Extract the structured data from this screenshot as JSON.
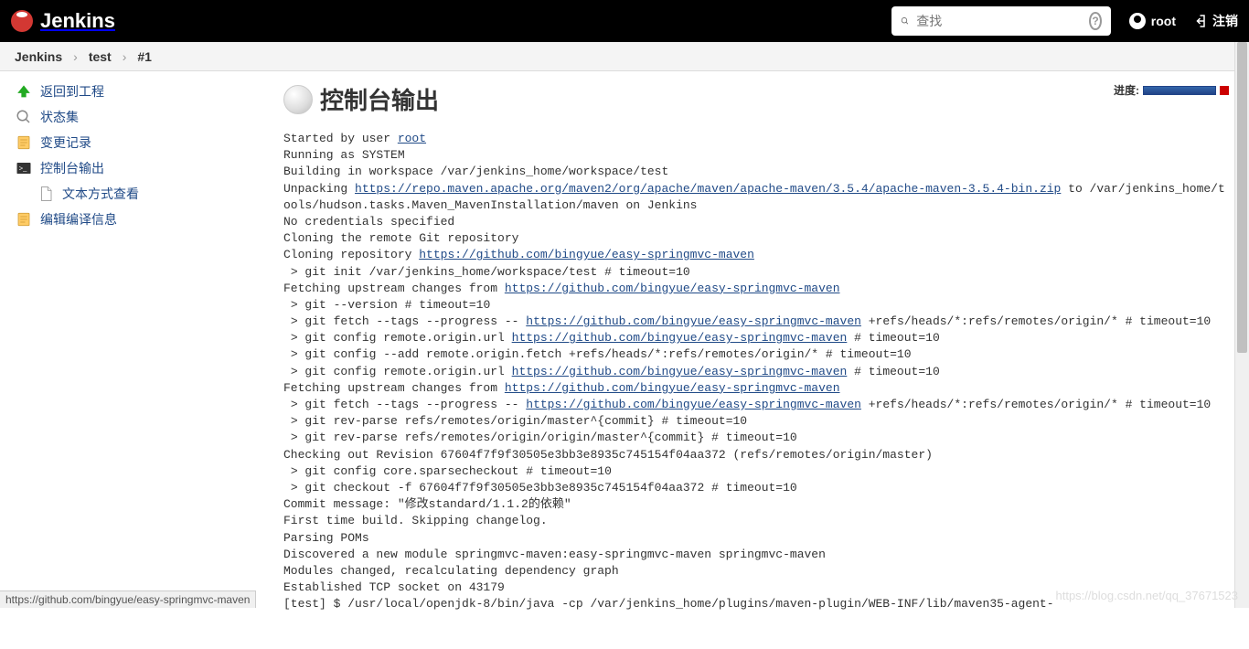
{
  "header": {
    "logo_text": "Jenkins",
    "search_placeholder": "查找",
    "username": "root",
    "logout_label": "注销"
  },
  "breadcrumb": {
    "items": [
      "Jenkins",
      "test",
      "#1"
    ]
  },
  "sidebar": {
    "items": [
      {
        "label": "返回到工程",
        "icon": "arrow-up"
      },
      {
        "label": "状态集",
        "icon": "search"
      },
      {
        "label": "变更记录",
        "icon": "notepad"
      },
      {
        "label": "控制台输出",
        "icon": "terminal"
      },
      {
        "label": "文本方式查看",
        "icon": "document",
        "sub": true
      },
      {
        "label": "编辑编译信息",
        "icon": "notepad"
      }
    ]
  },
  "progress": {
    "label": "进度:"
  },
  "page": {
    "title": "控制台输出"
  },
  "console": {
    "lines": [
      {
        "t": "Started by user "
      },
      {
        "a": "root",
        "href": "#"
      },
      {
        "br": 1
      },
      {
        "t": "Running as SYSTEM"
      },
      {
        "br": 1
      },
      {
        "t": "Building in workspace /var/jenkins_home/workspace/test"
      },
      {
        "br": 1
      },
      {
        "t": "Unpacking "
      },
      {
        "a": "https://repo.maven.apache.org/maven2/org/apache/maven/apache-maven/3.5.4/apache-maven-3.5.4-bin.zip",
        "href": "#"
      },
      {
        "t": " to /var/jenkins_home/tools/hudson.tasks.Maven_MavenInstallation/maven on Jenkins"
      },
      {
        "br": 1
      },
      {
        "t": "No credentials specified"
      },
      {
        "br": 1
      },
      {
        "t": "Cloning the remote Git repository"
      },
      {
        "br": 1
      },
      {
        "t": "Cloning repository "
      },
      {
        "a": "https://github.com/bingyue/easy-springmvc-maven",
        "href": "#"
      },
      {
        "br": 1
      },
      {
        "t": " > git init /var/jenkins_home/workspace/test # timeout=10"
      },
      {
        "br": 1
      },
      {
        "t": "Fetching upstream changes from "
      },
      {
        "a": "https://github.com/bingyue/easy-springmvc-maven",
        "href": "#"
      },
      {
        "br": 1
      },
      {
        "t": " > git --version # timeout=10"
      },
      {
        "br": 1
      },
      {
        "t": " > git fetch --tags --progress -- "
      },
      {
        "a": "https://github.com/bingyue/easy-springmvc-maven",
        "href": "#"
      },
      {
        "t": " +refs/heads/*:refs/remotes/origin/* # timeout=10"
      },
      {
        "br": 1
      },
      {
        "t": " > git config remote.origin.url "
      },
      {
        "a": "https://github.com/bingyue/easy-springmvc-maven",
        "href": "#"
      },
      {
        "t": " # timeout=10"
      },
      {
        "br": 1
      },
      {
        "t": " > git config --add remote.origin.fetch +refs/heads/*:refs/remotes/origin/* # timeout=10"
      },
      {
        "br": 1
      },
      {
        "t": " > git config remote.origin.url "
      },
      {
        "a": "https://github.com/bingyue/easy-springmvc-maven",
        "href": "#"
      },
      {
        "t": " # timeout=10"
      },
      {
        "br": 1
      },
      {
        "t": "Fetching upstream changes from "
      },
      {
        "a": "https://github.com/bingyue/easy-springmvc-maven",
        "href": "#"
      },
      {
        "br": 1
      },
      {
        "t": " > git fetch --tags --progress -- "
      },
      {
        "a": "https://github.com/bingyue/easy-springmvc-maven",
        "href": "#"
      },
      {
        "t": " +refs/heads/*:refs/remotes/origin/* # timeout=10"
      },
      {
        "br": 1
      },
      {
        "t": " > git rev-parse refs/remotes/origin/master^{commit} # timeout=10"
      },
      {
        "br": 1
      },
      {
        "t": " > git rev-parse refs/remotes/origin/origin/master^{commit} # timeout=10"
      },
      {
        "br": 1
      },
      {
        "t": "Checking out Revision 67604f7f9f30505e3bb3e8935c745154f04aa372 (refs/remotes/origin/master)"
      },
      {
        "br": 1
      },
      {
        "t": " > git config core.sparsecheckout # timeout=10"
      },
      {
        "br": 1
      },
      {
        "t": " > git checkout -f 67604f7f9f30505e3bb3e8935c745154f04aa372 # timeout=10"
      },
      {
        "br": 1
      },
      {
        "t": "Commit message: \"修改standard/1.1.2的依赖\""
      },
      {
        "br": 1
      },
      {
        "t": "First time build. Skipping changelog."
      },
      {
        "br": 1
      },
      {
        "t": "Parsing POMs"
      },
      {
        "br": 1
      },
      {
        "t": "Discovered a new module springmvc-maven:easy-springmvc-maven springmvc-maven"
      },
      {
        "br": 1
      },
      {
        "t": "Modules changed, recalculating dependency graph"
      },
      {
        "br": 1
      },
      {
        "t": "Established TCP socket on 43179"
      },
      {
        "br": 1
      },
      {
        "t": "[test] $ /usr/local/openjdk-8/bin/java -cp /var/jenkins_home/plugins/maven-plugin/WEB-INF/lib/maven35-agent-"
      }
    ]
  },
  "status_url": "https://github.com/bingyue/easy-springmvc-maven",
  "watermark": "https://blog.csdn.net/qq_37671523"
}
